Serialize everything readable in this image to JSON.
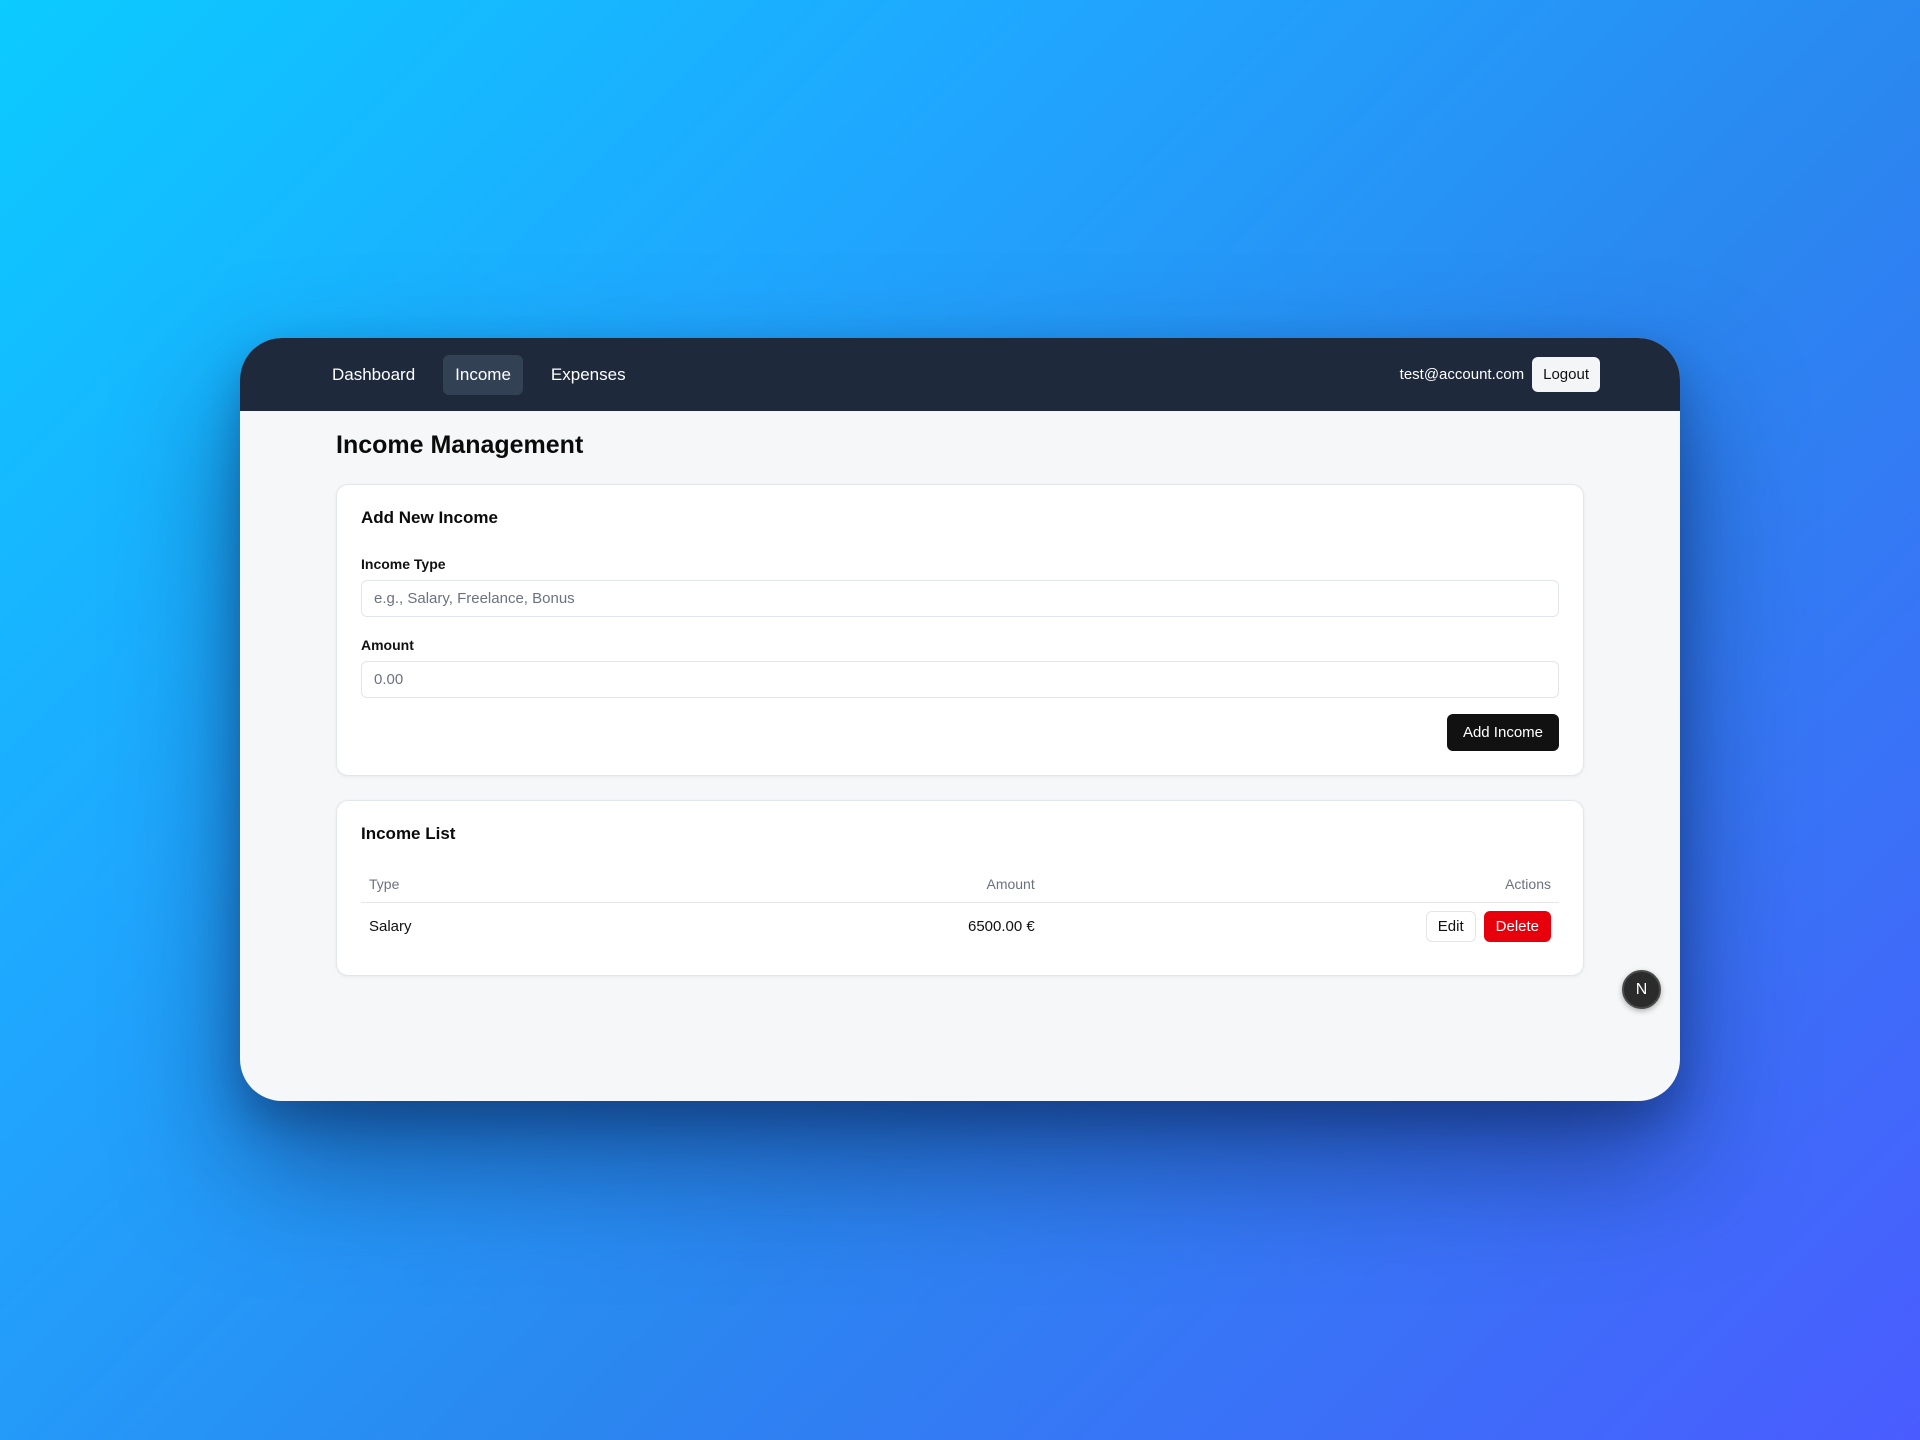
{
  "nav": {
    "links": [
      {
        "label": "Dashboard",
        "active": false
      },
      {
        "label": "Income",
        "active": true
      },
      {
        "label": "Expenses",
        "active": false
      }
    ],
    "user_email": "test@account.com",
    "logout_label": "Logout"
  },
  "page": {
    "title": "Income Management"
  },
  "add_form": {
    "title": "Add New Income",
    "type_label": "Income Type",
    "type_placeholder": "e.g., Salary, Freelance, Bonus",
    "amount_label": "Amount",
    "amount_placeholder": "0.00",
    "submit_label": "Add Income"
  },
  "income_list": {
    "title": "Income List",
    "columns": [
      "Type",
      "Amount",
      "Actions"
    ],
    "rows": [
      {
        "type": "Salary",
        "amount": "6500.00 €",
        "edit_label": "Edit",
        "delete_label": "Delete"
      }
    ]
  },
  "badge": {
    "letter": "N",
    "icon": "nextjs-logo-icon"
  },
  "colors": {
    "navbar": "#1e293b",
    "nav_active": "#334155",
    "primary_button": "#111111",
    "delete_button": "#e7000b"
  }
}
